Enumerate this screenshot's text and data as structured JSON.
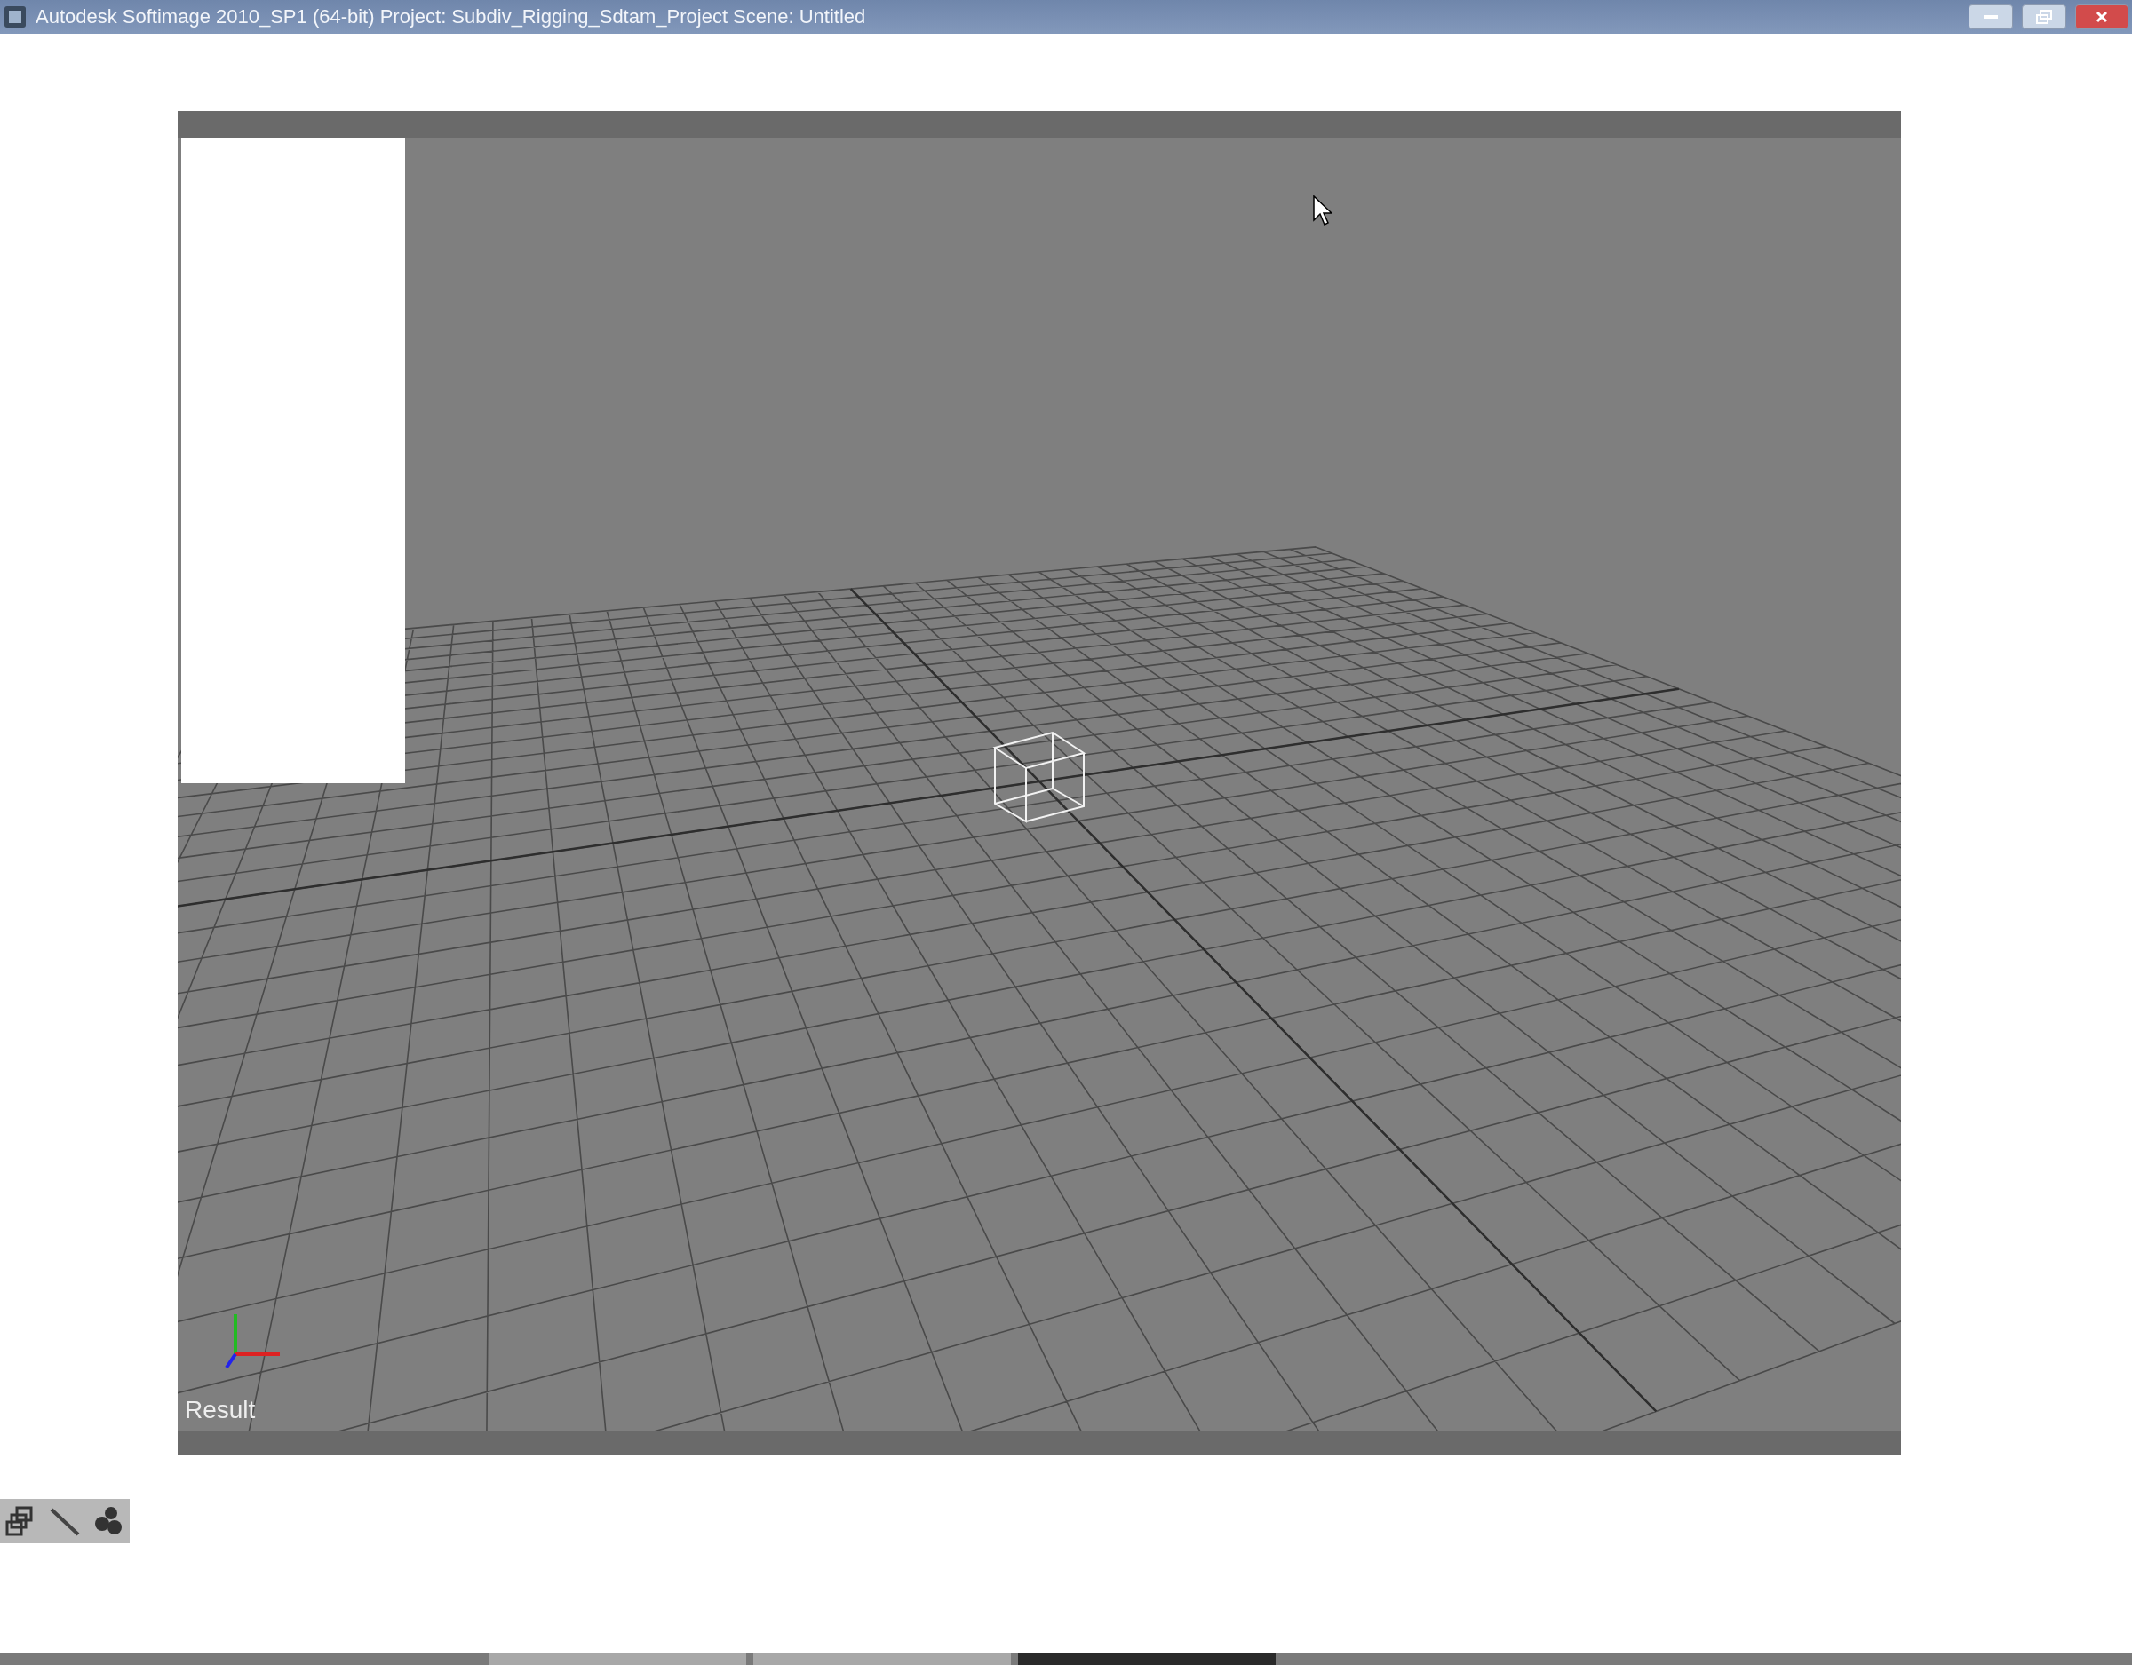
{
  "window": {
    "title": "Autodesk Softimage 2010_SP1 (64-bit)    Project: Subdiv_Rigging_Sdtam_Project    Scene: Untitled"
  },
  "viewport": {
    "label": "Result"
  }
}
